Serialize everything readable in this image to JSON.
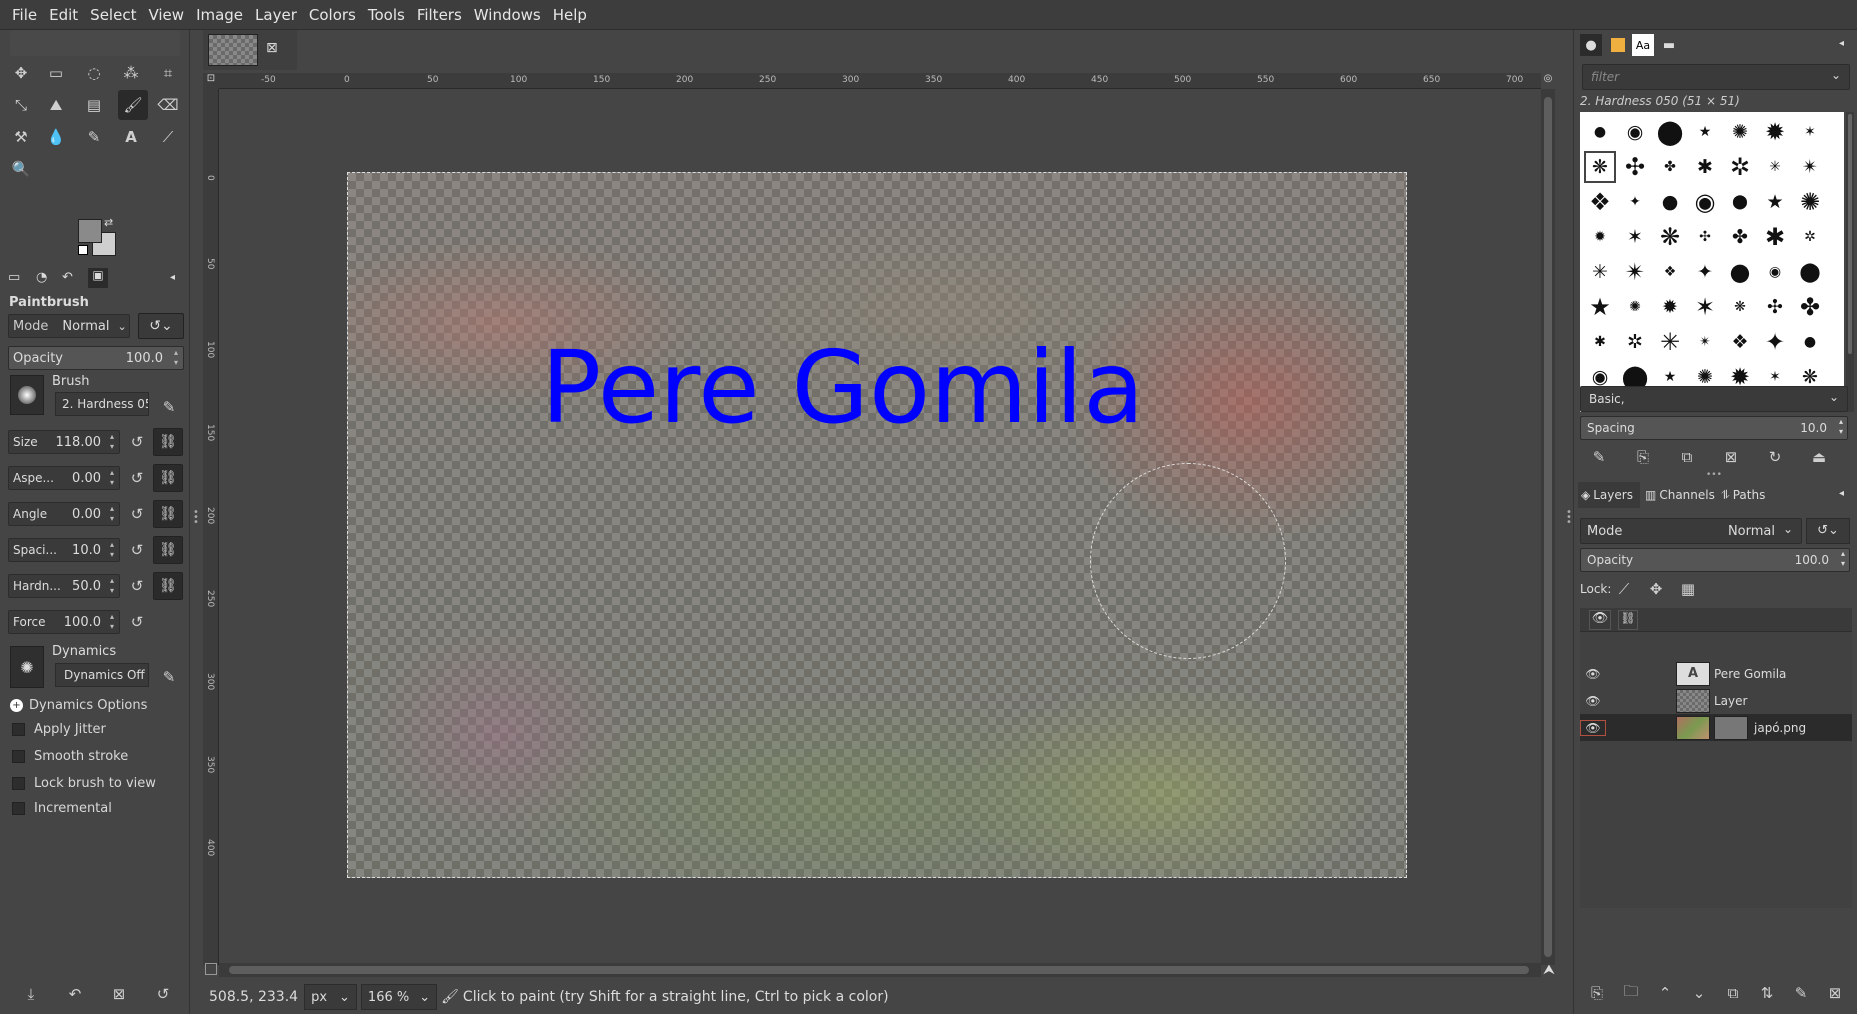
{
  "menubar": {
    "items": [
      "File",
      "Edit",
      "Select",
      "View",
      "Image",
      "Layer",
      "Colors",
      "Tools",
      "Filters",
      "Windows",
      "Help"
    ]
  },
  "image_tab": {
    "close_icon": "close-icon"
  },
  "tool_options": {
    "title": "Paintbrush",
    "mode_label": "Mode",
    "mode_value": "Normal",
    "opacity_label": "Opacity",
    "opacity_value": "100.0",
    "brush_label": "Brush",
    "brush_value": "2. Hardness 050",
    "size_label": "Size",
    "size_value": "118.00",
    "aspect_label": "Aspe...",
    "aspect_value": "0.00",
    "angle_label": "Angle",
    "angle_value": "0.00",
    "spacing_label": "Spaci...",
    "spacing_value": "10.0",
    "hardness_label": "Hardn...",
    "hardness_value": "50.0",
    "force_label": "Force",
    "force_value": "100.0",
    "dynamics_label": "Dynamics",
    "dynamics_value": "Dynamics Off",
    "dynamics_options": "Dynamics Options",
    "apply_jitter": "Apply Jitter",
    "smooth_stroke": "Smooth stroke",
    "lock_brush": "Lock brush to view",
    "incremental": "Incremental"
  },
  "canvas": {
    "overlay_text": "Pere Gomila",
    "ruler_top": [
      "-50",
      "0",
      "50",
      "100",
      "150",
      "200",
      "250",
      "300",
      "350",
      "400",
      "450",
      "500",
      "550",
      "600",
      "650",
      "700"
    ],
    "ruler_left": [
      "0",
      "50",
      "100",
      "150",
      "200",
      "250",
      "300",
      "350",
      "400"
    ]
  },
  "status": {
    "coords": "508.5, 233.4",
    "unit": "px",
    "zoom": "166 %",
    "message": "Click to paint (try Shift for a straight line, Ctrl to pick a color)"
  },
  "brushes_panel": {
    "filter_placeholder": "filter",
    "selected_brush": "2. Hardness 050 (51 × 51)",
    "preset": "Basic,",
    "spacing_label": "Spacing",
    "spacing_value": "10.0"
  },
  "layers_panel": {
    "tabs": [
      "Layers",
      "Channels",
      "Paths"
    ],
    "mode_label": "Mode",
    "mode_value": "Normal",
    "opacity_label": "Opacity",
    "opacity_value": "100.0",
    "lock_label": "Lock:",
    "layers": [
      {
        "name": "Pere Gomila"
      },
      {
        "name": "Layer"
      },
      {
        "name": "japó.png"
      }
    ]
  },
  "colors": {
    "accent_text": "#0000ff",
    "fg_color": "#8a8a8a",
    "bg_color": "#cfcfcf"
  }
}
